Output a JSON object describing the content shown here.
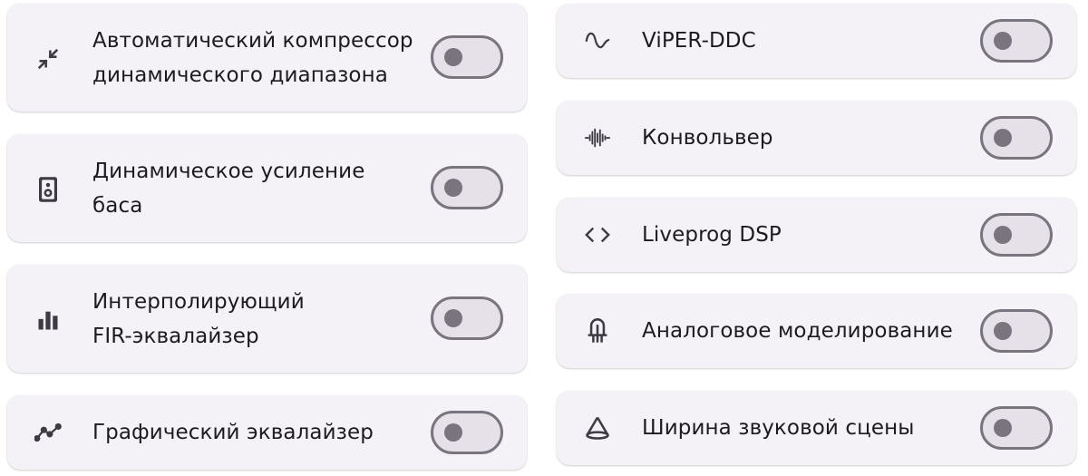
{
  "left_column": [
    {
      "line1": "Автоматический компрессор",
      "line2": "динамического диапазона",
      "icon": "compress-icon",
      "enabled": false
    },
    {
      "line1": "Динамическое усиление",
      "line2": "баса",
      "icon": "speaker-icon",
      "enabled": false
    },
    {
      "line1": "Интерполирующий",
      "line2": "FIR-эквалайзер",
      "icon": "bar-chart-icon",
      "enabled": false
    },
    {
      "line1": "Графический эквалайзер",
      "icon": "line-graph-icon",
      "enabled": false
    }
  ],
  "right_column": [
    {
      "label": "ViPER-DDC",
      "icon": "sine-wave-icon",
      "enabled": false
    },
    {
      "label": "Конвольвер",
      "icon": "waveform-icon",
      "enabled": false
    },
    {
      "label": "Liveprog DSP",
      "icon": "code-icon",
      "enabled": false
    },
    {
      "label": "Аналоговое моделирование",
      "icon": "vacuum-tube-icon",
      "enabled": false
    },
    {
      "label": "Ширина звуковой сцены",
      "icon": "cone-icon",
      "enabled": false
    }
  ],
  "colors": {
    "card_background": "#f5f2f7",
    "toggle_track": "#e6e0e9",
    "toggle_outline": "#79747e",
    "text": "#1d1b20"
  }
}
